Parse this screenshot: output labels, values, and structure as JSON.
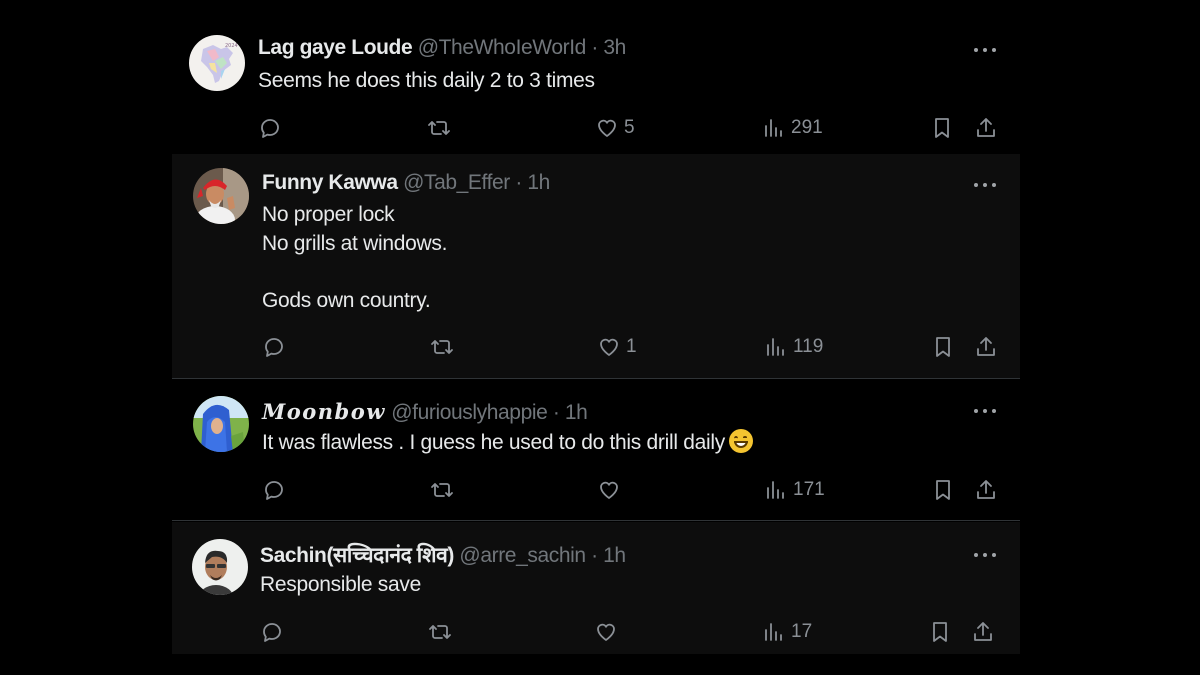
{
  "tweets": [
    {
      "name": "Lag gaye Loude",
      "handle": "@TheWhoIeWorId",
      "separator": "·",
      "time": "3h",
      "lines": [
        "Seems he does this daily 2 to 3 times"
      ],
      "likes": "5",
      "views": "291",
      "avatar": "india-map-avatar"
    },
    {
      "name": "Funny Kawwa",
      "handle": "@Tab_Effer",
      "separator": "·",
      "time": "1h",
      "lines": [
        "No proper lock",
        "No grills at windows.",
        "",
        "Gods own country."
      ],
      "likes": "1",
      "views": "119",
      "avatar": "man-red-turban-avatar"
    },
    {
      "name": "𝑴𝒐𝒐𝒏𝒃𝒐𝒘",
      "handle": "@furiouslyhappie",
      "separator": "·",
      "time": "1h",
      "lines": [
        "It was flawless . I guess he used to do this drill daily"
      ],
      "emoji": "grinning-face-emoji",
      "likes": "",
      "views": "171",
      "avatar": "blue-hair-avatar"
    },
    {
      "name": "Sachin(सच्चिदानंद शिव)",
      "handle": "@arre_sachin",
      "separator": "·",
      "time": "1h",
      "lines": [
        "Responsible save"
      ],
      "likes": "",
      "views": "17",
      "avatar": "man-portrait-avatar"
    }
  ],
  "icons": {
    "reply": "reply-icon",
    "repost": "repost-icon",
    "like": "heart-icon",
    "views": "views-icon",
    "bookmark": "bookmark-icon",
    "share": "share-icon",
    "more": "more-icon"
  },
  "colors": {
    "background": "#000000",
    "alt_background": "#0d0d0d",
    "text": "#e7e9ea",
    "secondary": "#71767b"
  }
}
